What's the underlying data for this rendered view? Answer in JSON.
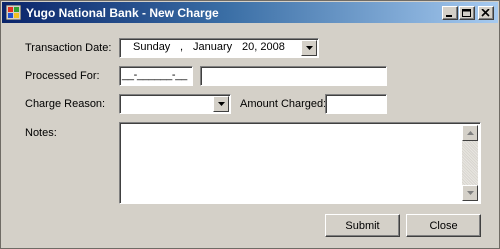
{
  "window": {
    "title": "Yugo National Bank - New Charge"
  },
  "form": {
    "transaction_date_label": "Transaction Date:",
    "date": {
      "weekday": "Sunday",
      "sep1": ",",
      "month": "January",
      "day_year": "20, 2008"
    },
    "processed_for_label": "Processed For:",
    "account_mask": "__-______-__",
    "customer_name": "",
    "charge_reason_label": "Charge Reason:",
    "charge_reason_value": "",
    "amount_charged_label": "Amount Charged:",
    "amount_value": "",
    "notes_label": "Notes:",
    "notes_value": ""
  },
  "buttons": {
    "submit": "Submit",
    "close": "Close"
  },
  "icons": {
    "app": "windows-form-icon",
    "minimize": "minimize-icon",
    "maximize": "maximize-icon",
    "close": "close-icon"
  }
}
